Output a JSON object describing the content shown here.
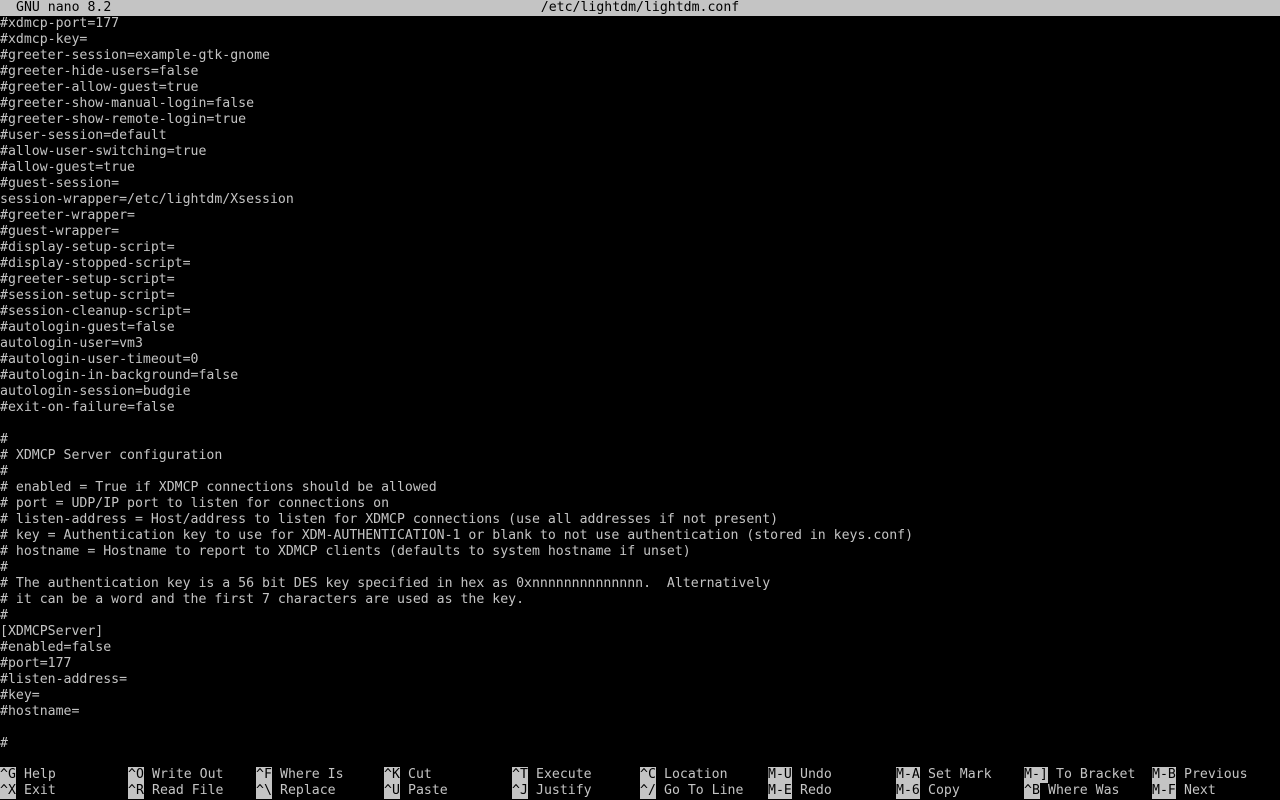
{
  "titlebar": {
    "app": "GNU nano 8.2",
    "file": "/etc/lightdm/lightdm.conf"
  },
  "lines": [
    "#xdmcp-port=177",
    "#xdmcp-key=",
    "#greeter-session=example-gtk-gnome",
    "#greeter-hide-users=false",
    "#greeter-allow-guest=true",
    "#greeter-show-manual-login=false",
    "#greeter-show-remote-login=true",
    "#user-session=default",
    "#allow-user-switching=true",
    "#allow-guest=true",
    "#guest-session=",
    "session-wrapper=/etc/lightdm/Xsession",
    "#greeter-wrapper=",
    "#guest-wrapper=",
    "#display-setup-script=",
    "#display-stopped-script=",
    "#greeter-setup-script=",
    "#session-setup-script=",
    "#session-cleanup-script=",
    "#autologin-guest=false",
    "autologin-user=vm3",
    "#autologin-user-timeout=0",
    "#autologin-in-background=false",
    "autologin-session=budgie",
    "#exit-on-failure=false",
    "",
    "#",
    "# XDMCP Server configuration",
    "#",
    "# enabled = True if XDMCP connections should be allowed",
    "# port = UDP/IP port to listen for connections on",
    "# listen-address = Host/address to listen for XDMCP connections (use all addresses if not present)",
    "# key = Authentication key to use for XDM-AUTHENTICATION-1 or blank to not use authentication (stored in keys.conf)",
    "# hostname = Hostname to report to XDMCP clients (defaults to system hostname if unset)",
    "#",
    "# The authentication key is a 56 bit DES key specified in hex as 0xnnnnnnnnnnnnnn.  Alternatively",
    "# it can be a word and the first 7 characters are used as the key.",
    "#",
    "[XDMCPServer]",
    "#enabled=false",
    "#port=177",
    "#listen-address=",
    "#key=",
    "#hostname=",
    "",
    "#"
  ],
  "shortcuts": [
    {
      "key": "^G",
      "label": "Help"
    },
    {
      "key": "^X",
      "label": "Exit"
    },
    {
      "key": "^O",
      "label": "Write Out"
    },
    {
      "key": "^R",
      "label": "Read File"
    },
    {
      "key": "^F",
      "label": "Where Is"
    },
    {
      "key": "^\\",
      "label": "Replace"
    },
    {
      "key": "^K",
      "label": "Cut"
    },
    {
      "key": "^U",
      "label": "Paste"
    },
    {
      "key": "^T",
      "label": "Execute"
    },
    {
      "key": "^J",
      "label": "Justify"
    },
    {
      "key": "^C",
      "label": "Location"
    },
    {
      "key": "^/",
      "label": "Go To Line"
    },
    {
      "key": "M-U",
      "label": "Undo"
    },
    {
      "key": "M-E",
      "label": "Redo"
    },
    {
      "key": "M-A",
      "label": "Set Mark"
    },
    {
      "key": "M-6",
      "label": "Copy"
    },
    {
      "key": "M-]",
      "label": "To Bracket"
    },
    {
      "key": "^B",
      "label": "Where Was"
    },
    {
      "key": "M-B",
      "label": "Previous"
    },
    {
      "key": "M-F",
      "label": "Next"
    }
  ],
  "colors": {
    "background": "#000000",
    "foreground": "#c4c4c4",
    "bar": "#c4c4c4"
  }
}
